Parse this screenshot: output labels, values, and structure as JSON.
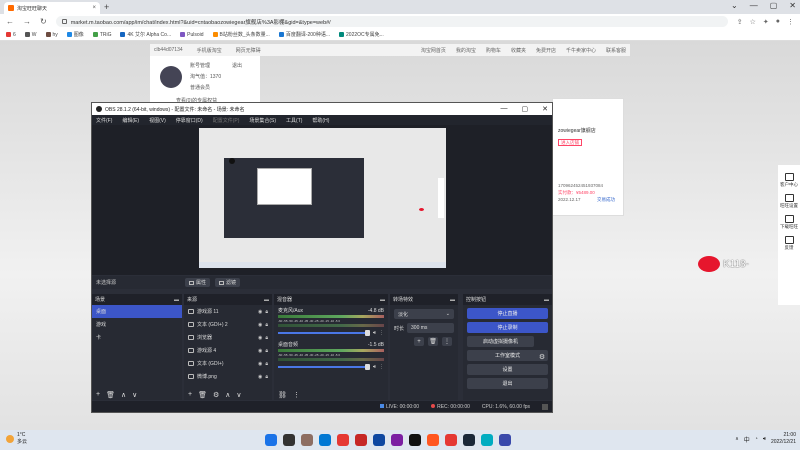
{
  "browser": {
    "tab_title": "淘宝旺旺聊天",
    "tab_close": "×",
    "newtab": "+",
    "win_buttons": [
      "⌄",
      "—",
      "▢",
      "✕"
    ],
    "nav": [
      "←",
      "→",
      "↻"
    ],
    "url": "market.m.taobao.com/app/im/chat/index.html?&uid=cntaobaozowiegear旗舰店%3A影棚&gid=&type=web#/",
    "bookmarks": [
      "6",
      "W",
      "hy",
      "图像",
      "TRiG",
      "4K 艾尔 Alpha Co...",
      "Pulsoid",
      "B站粉丝数_头条数量...",
      "百度翻译-200种语...",
      "2022OC专属免..."
    ],
    "bookmark_colors": [
      "#e53935",
      "#555555",
      "#6d4c41",
      "#1e88e5",
      "#43a047",
      "#1565c0",
      "#7e57c2",
      "#fb8c00",
      "#1976d2",
      "#00897b"
    ]
  },
  "page": {
    "top_bar_left": [
      "clb44d07134",
      "手机版淘宝",
      "网页无障碍"
    ],
    "top_bar_right": [
      "淘宝网首页",
      "我的淘宝",
      "购物车",
      "收藏夹",
      "免费开店",
      "千牛卖家中心",
      "联系客服"
    ],
    "user_name": "clb44d07134",
    "user_links": [
      "账号管理",
      "退出"
    ],
    "user_level": "淘气值：1370",
    "user_member": "普通会员",
    "user_note": "查看(0)的专属权益",
    "chat_shop": "zowiegear旗舰店",
    "chat_enter": "进入店铺",
    "chat_order_no": "1709624524519370​84",
    "chat_order_paid": "实付款：¥5489.00",
    "chat_order_date": "2022.12.17",
    "chat_order_link": "交易成功",
    "right_bar": [
      "客户中心",
      "旺旺设置",
      "下载旺旺",
      "反馈"
    ],
    "weibo_tag": "K118-"
  },
  "obs": {
    "title": "OBS 28.1.2 (64-bit, windows) - 配置文件: 未命名 - 场景: 未命名",
    "win_buttons": [
      "—",
      "▢",
      "✕"
    ],
    "menu": [
      "文件(F)",
      "编辑(E)",
      "视图(V)",
      "停靠窗口(D)",
      "配置文件(P)",
      "场景集合(S)",
      "工具(T)",
      "帮助(H)"
    ],
    "no_source": "未选择源",
    "props_btn": "属性",
    "filter_btn": "滤镜",
    "scenes_title": "场景",
    "scenes": [
      "桌面",
      "游戏",
      "卡"
    ],
    "sources_title": "来源",
    "sources": [
      "游戏源 11",
      "文本 (GDI+) 2",
      "浏览器",
      "游戏源 4",
      "文本 (GDI+)",
      "微博.png"
    ],
    "mixer_title": "混音器",
    "mixer": [
      {
        "name": "麦克风/Aux",
        "db": "-4.8 dB"
      },
      {
        "name": "桌面音频",
        "db": "-1.5 dB"
      }
    ],
    "meter_scale": "-60 -55 -50 -45 -40 -35 -30 -25 -20 -15 -10 -5 0",
    "trans_title": "转场特效",
    "trans_select": "淡化",
    "trans_dur_label": "时长",
    "trans_dur": "300 ms",
    "ctl_title": "控制按钮",
    "controls": [
      "停止直播",
      "停止录制",
      "启动虚拟摄像机",
      "工作室模式",
      "设置",
      "退出"
    ],
    "status_live": "LIVE: 00:00:00",
    "status_rec": "REC: 00:00:00",
    "status_cpu": "CPU: 1.6%, 60.00 fps",
    "foot_symbols": {
      "add": "+",
      "remove": "🗑",
      "up": "∧",
      "down": "∨",
      "gear": "⚙",
      "more": "⋮",
      "link": "⛓"
    }
  },
  "taskbar": {
    "temp": "1°C",
    "weather": "多云",
    "icon_colors": [
      "#1a73e8",
      "#333333",
      "#8d6e63",
      "#0078d4",
      "#e53935",
      "#c62828",
      "#0d47a1",
      "#7b1fa2",
      "#111111",
      "#ff5722",
      "#e53935",
      "#1b2838",
      "#00acc1",
      "#3949ab"
    ],
    "ime": "中",
    "time": "21:00",
    "date": "2022/12/21"
  }
}
